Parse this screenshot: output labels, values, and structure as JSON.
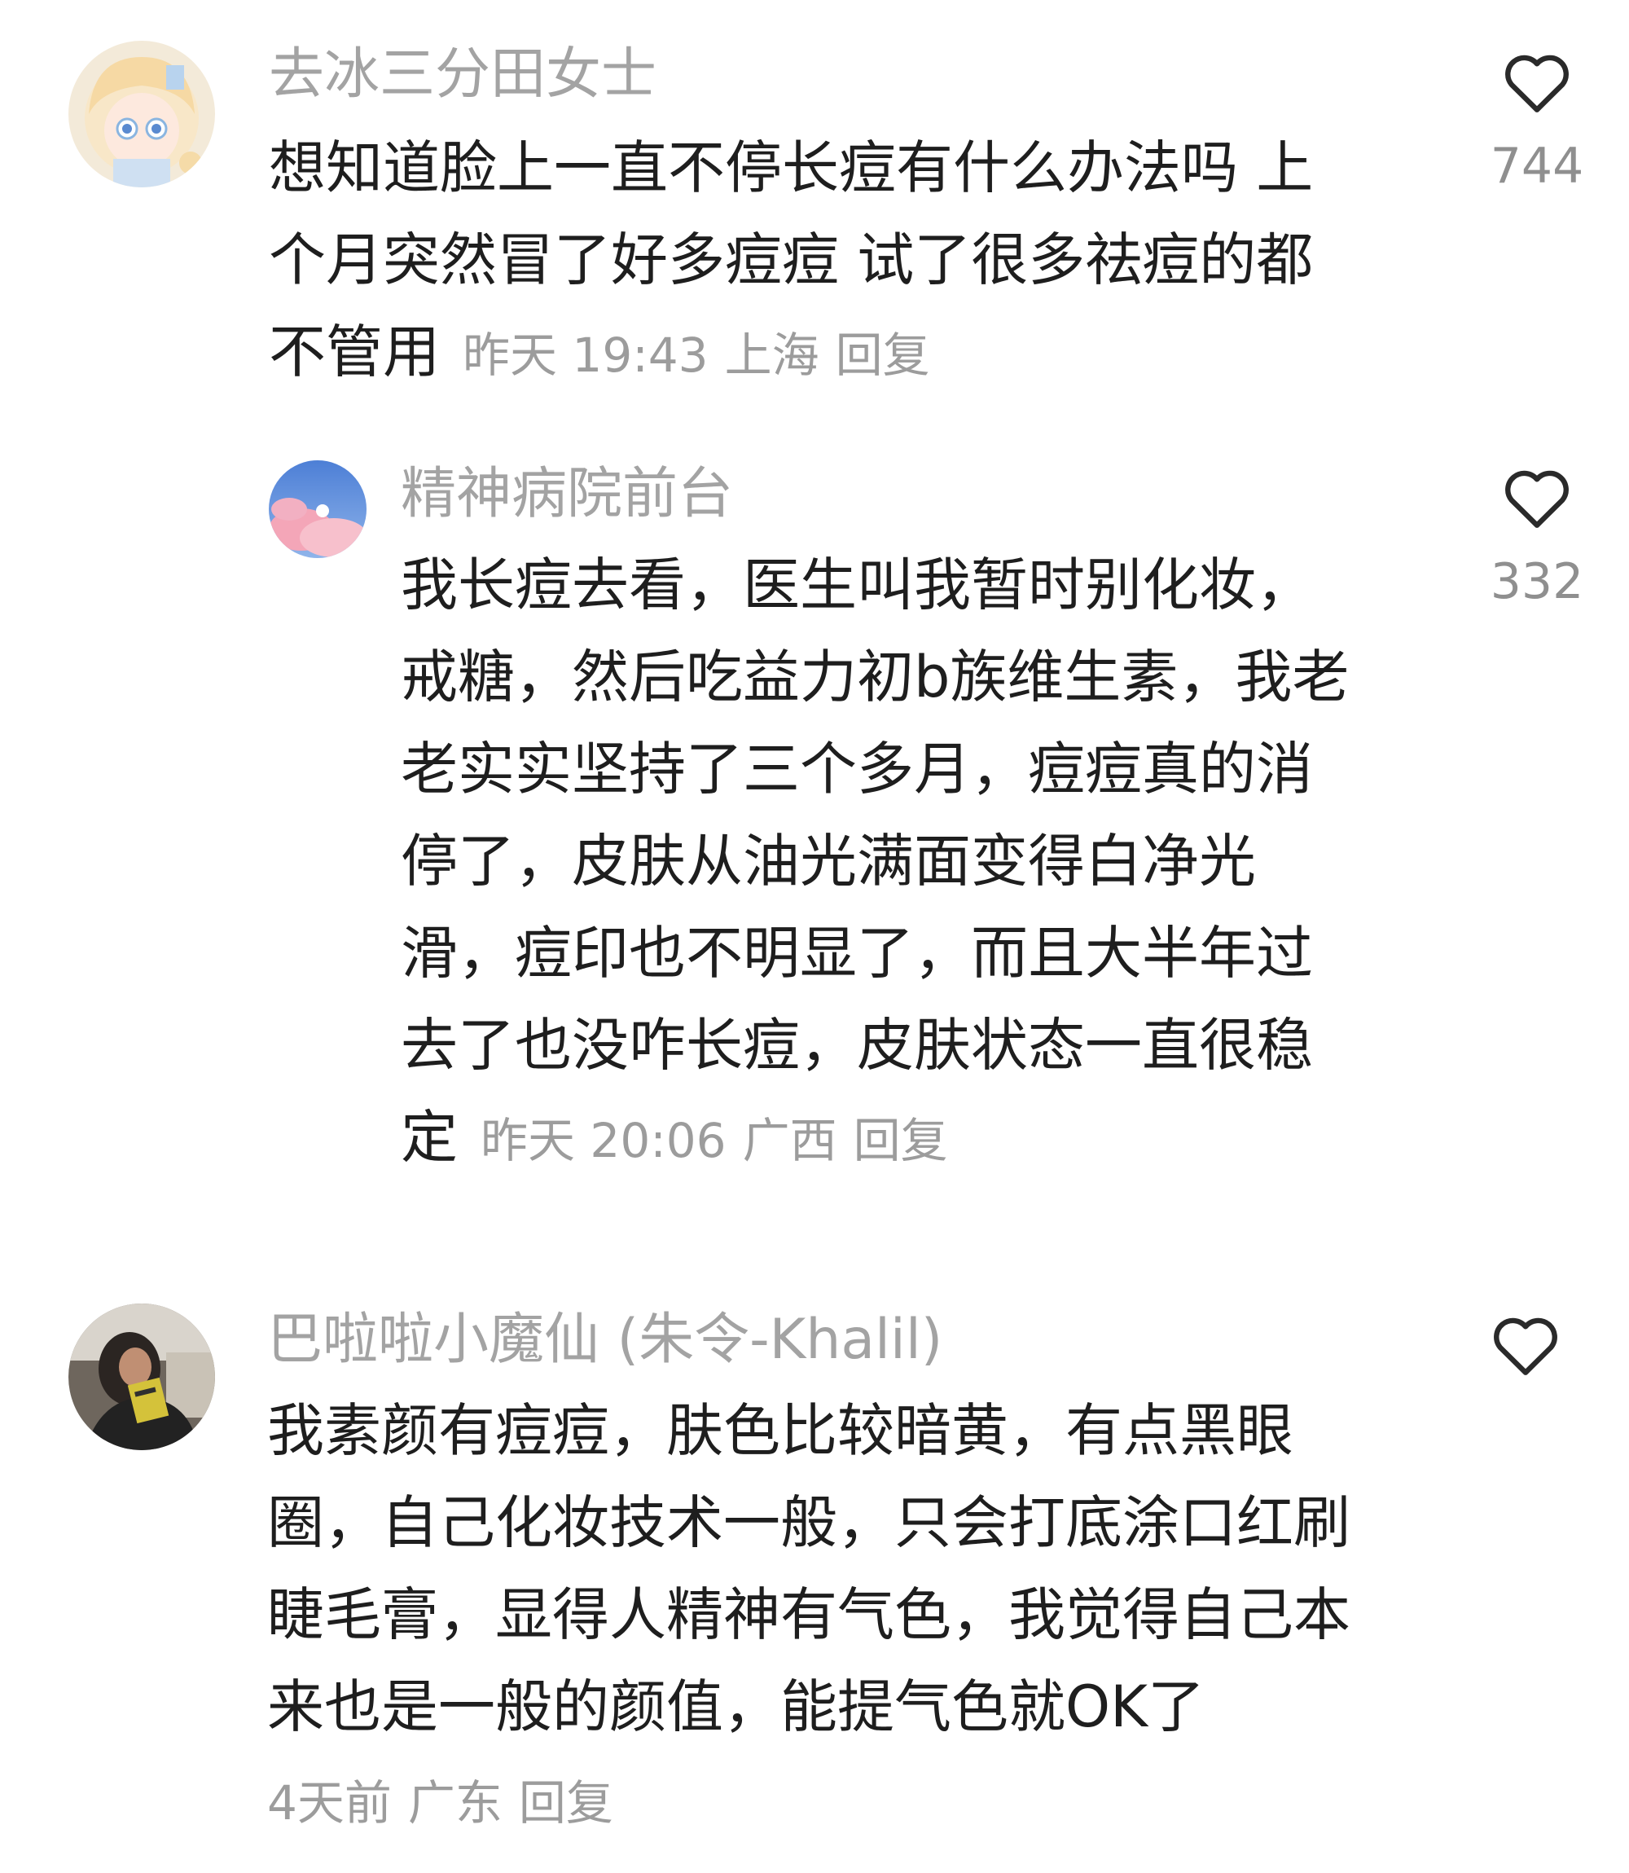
{
  "comments": [
    {
      "username": "去冰三分田女士",
      "text": "想知道脸上一直不停长痘有什么办法吗 上个月突然冒了好多痘痘 试了很多祛痘的都不管用",
      "time": "昨天 19:43",
      "location": "上海",
      "reply_label": "回复",
      "likes": "744",
      "avatar_icon": "anime-girl-avatar-icon"
    },
    {
      "username": "精神病院前台",
      "text": "我长痘去看，医生叫我暂时别化妆，戒糖，然后吃益力初b族维生素，我老老实实坚持了三个多月，痘痘真的消停了，皮肤从油光满面变得白净光滑，痘印也不明显了，而且大半年过去了也没咋长痘，皮肤状态一直很稳定",
      "time": "昨天 20:06",
      "location": "广西",
      "reply_label": "回复",
      "likes": "332",
      "avatar_icon": "pink-cloud-sky-avatar-icon"
    },
    {
      "username": "巴啦啦小魔仙 (朱令-Khalil)",
      "text": "我素颜有痘痘，肤色比较暗黄，有点黑眼圈，自己化妆技术一般，只会打底涂口红刷睫毛膏，显得人精神有气色，我觉得自己本来也是一般的颜值，能提气色就OK了",
      "time": "4天前",
      "location": "广东",
      "reply_label": "回复",
      "likes": "",
      "avatar_icon": "reading-person-avatar-icon"
    }
  ],
  "icons": {
    "like": "heart-outline-icon"
  },
  "colors": {
    "username": "#a3a3a3",
    "meta": "#9c9c9c",
    "text": "#1e1e1e",
    "like_count": "#8f8f8f"
  }
}
